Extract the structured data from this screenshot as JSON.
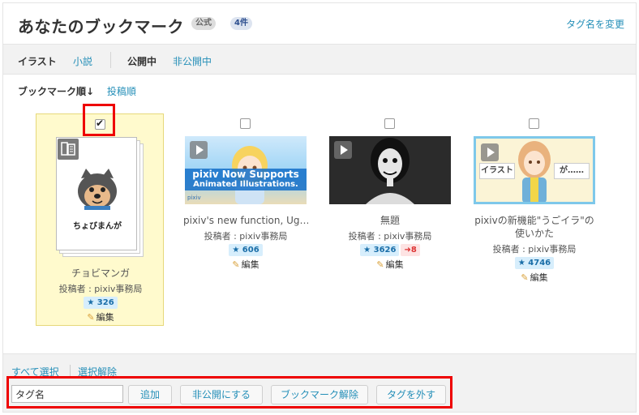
{
  "header": {
    "title": "あなたのブックマーク",
    "badge_official": "公式",
    "badge_count": "4件",
    "rename_tag": "タグ名を変更"
  },
  "filters": {
    "illust": "イラスト",
    "novel": "小説",
    "public": "公開中",
    "private": "非公開中"
  },
  "sort": {
    "bookmark_order": "ブックマーク順↓",
    "post_order": "投稿順"
  },
  "works": [
    {
      "title": "チョビマンガ",
      "author": "投稿者 : pixiv事務局",
      "bookmarks": "326",
      "edit": "編集",
      "selected": true
    },
    {
      "title": "pixiv's new function, Ug…",
      "author": "投稿者 : pixiv事務局",
      "bookmarks": "606",
      "edit": "編集",
      "selected": false
    },
    {
      "title": "無題",
      "author": "投稿者 : pixiv事務局",
      "bookmarks": "3626",
      "reposts": "8",
      "edit": "編集",
      "selected": false
    },
    {
      "title": "pixivの新機能\"うごイラ\"の使いかた",
      "author": "投稿者 : pixiv事務局",
      "bookmarks": "4746",
      "edit": "編集",
      "selected": false
    }
  ],
  "thumb_text": {
    "manga_label": "ちょびまんが",
    "video_line1": "pixiv Now Supports",
    "video_line2": "Animated Illustrations.",
    "video_brand": "pixiv",
    "guide_left": "イラスト",
    "guide_right": "が……"
  },
  "bottom": {
    "select_all": "すべて選択",
    "deselect": "選択解除",
    "tag_input_value": "タグ名",
    "add": "追加",
    "make_private": "非公開にする",
    "remove_bookmark": "ブックマーク解除",
    "remove_tag": "タグを外す"
  },
  "colors": {
    "link": "#258fb8",
    "selected_bg": "#fffacd",
    "highlight": "#e00000"
  }
}
